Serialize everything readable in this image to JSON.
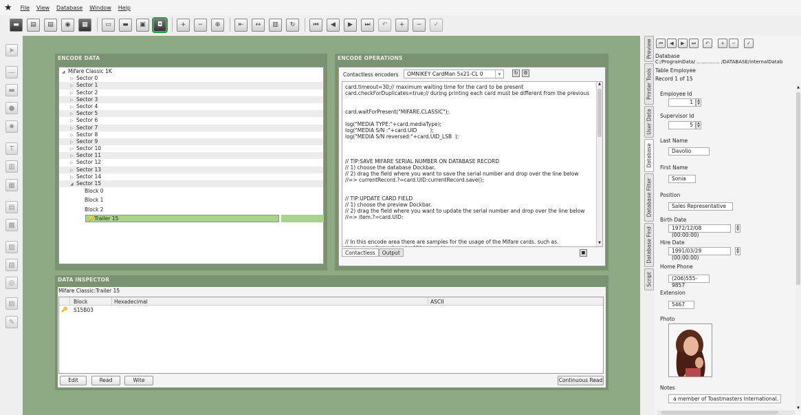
{
  "menu": [
    "File",
    "View",
    "Database",
    "Window",
    "Help"
  ],
  "encode_data": {
    "title": "ENCODE DATA",
    "root": "Mifare Classic 1K",
    "sectors": [
      "Sector 0",
      "Sector 1",
      "Sector 2",
      "Sector 3",
      "Sector 4",
      "Sector 5",
      "Sector 6",
      "Sector 7",
      "Sector 8",
      "Sector 9",
      "Sector 10",
      "Sector 11",
      "Sector 12",
      "Sector 13",
      "Sector 14",
      "Sector 15"
    ],
    "blocks": [
      "Block 0",
      "Block 1",
      "Block 2"
    ],
    "trailer": "Trailer 15"
  },
  "encode_ops": {
    "title": "ENCODE OPERATIONS",
    "encoders_label": "Contactless encoders",
    "encoder_value": "OMNIKEY CardMan 5x21-CL 0",
    "code": [
      "card.timeout=30;// maximum waiting time for the card to be present",
      "card.checkForDuplicates=true;// during printing each card must be different from the previous",
      "",
      "",
      "card.waitForPresent(\"MIFARE.CLASSIC\");",
      "",
      "log(\"MEDIA TYPE:\"+card.mediaType);",
      "log(\"MEDIA S/N :\"+card.UID        );",
      "log(\"MEDIA S/N reversed:\"+card.UID_LSB  );",
      "",
      "",
      "",
      "// TIP:SAVE MIFARE SERIAL NUMBER ON DATABASE RECORD",
      "// 1) choose the database Dockbar.",
      "// 2) drag the field where you want to save the serial number and drop over the line below",
      "//=> currentRecord.?=card.UID:currentRecord.save();",
      "",
      "",
      "// TIP:UPDATE CARD FIELD",
      "// 1) choose the preview Dockbar.",
      "// 2) drag the field where you want to update the serial number and drop over the line below",
      "//=> item.?=card.UID:",
      "",
      "",
      "",
      "// In this encode area there are samples for the usage of the Mifare cards. such as.",
      "// how to write and read a Mifare card in"
    ],
    "tabs": [
      "Contactless",
      "Output"
    ]
  },
  "inspector": {
    "title": "DATA INSPECTOR",
    "path": "Mifare Classic:Trailer 15",
    "columns": [
      "Block",
      "Hexadecimal",
      "ASCII"
    ],
    "rows": [
      {
        "block": "S15B03"
      }
    ],
    "buttons": {
      "edit": "Edit",
      "read": "Read",
      "write": "Wite",
      "continuous": "Continuous Read"
    }
  },
  "side_tabs": [
    "Preview",
    "Printer Tools",
    "User Data",
    "Database",
    "Database Filter",
    "Database Find",
    "Script"
  ],
  "database": {
    "label": "Database",
    "path": "C:/ProgramData/ ............... /DATABASE/internalDatab",
    "table": "Table Employee",
    "record": "Record 1 of 15",
    "fields": [
      {
        "label": "Employee Id",
        "value": "1"
      },
      {
        "label": "Supervisor Id",
        "value": "5"
      },
      {
        "label": "Last Name",
        "value": "Davolio"
      },
      {
        "label": "First Name",
        "value": "Sonia"
      },
      {
        "label": "Position",
        "value": "Sales Representative"
      },
      {
        "label": "Birth Date",
        "value": "1972/12/08 (00:00:00)"
      },
      {
        "label": "Hire Date",
        "value": "1991/03/29 (00:00:00)"
      },
      {
        "label": "Home Phone",
        "value": "(206)555-9857"
      },
      {
        "label": "Extension",
        "value": "5467"
      }
    ],
    "photo_label": "Photo",
    "notes_label": "Notes",
    "notes_value": "a member of Toastmasters International."
  }
}
